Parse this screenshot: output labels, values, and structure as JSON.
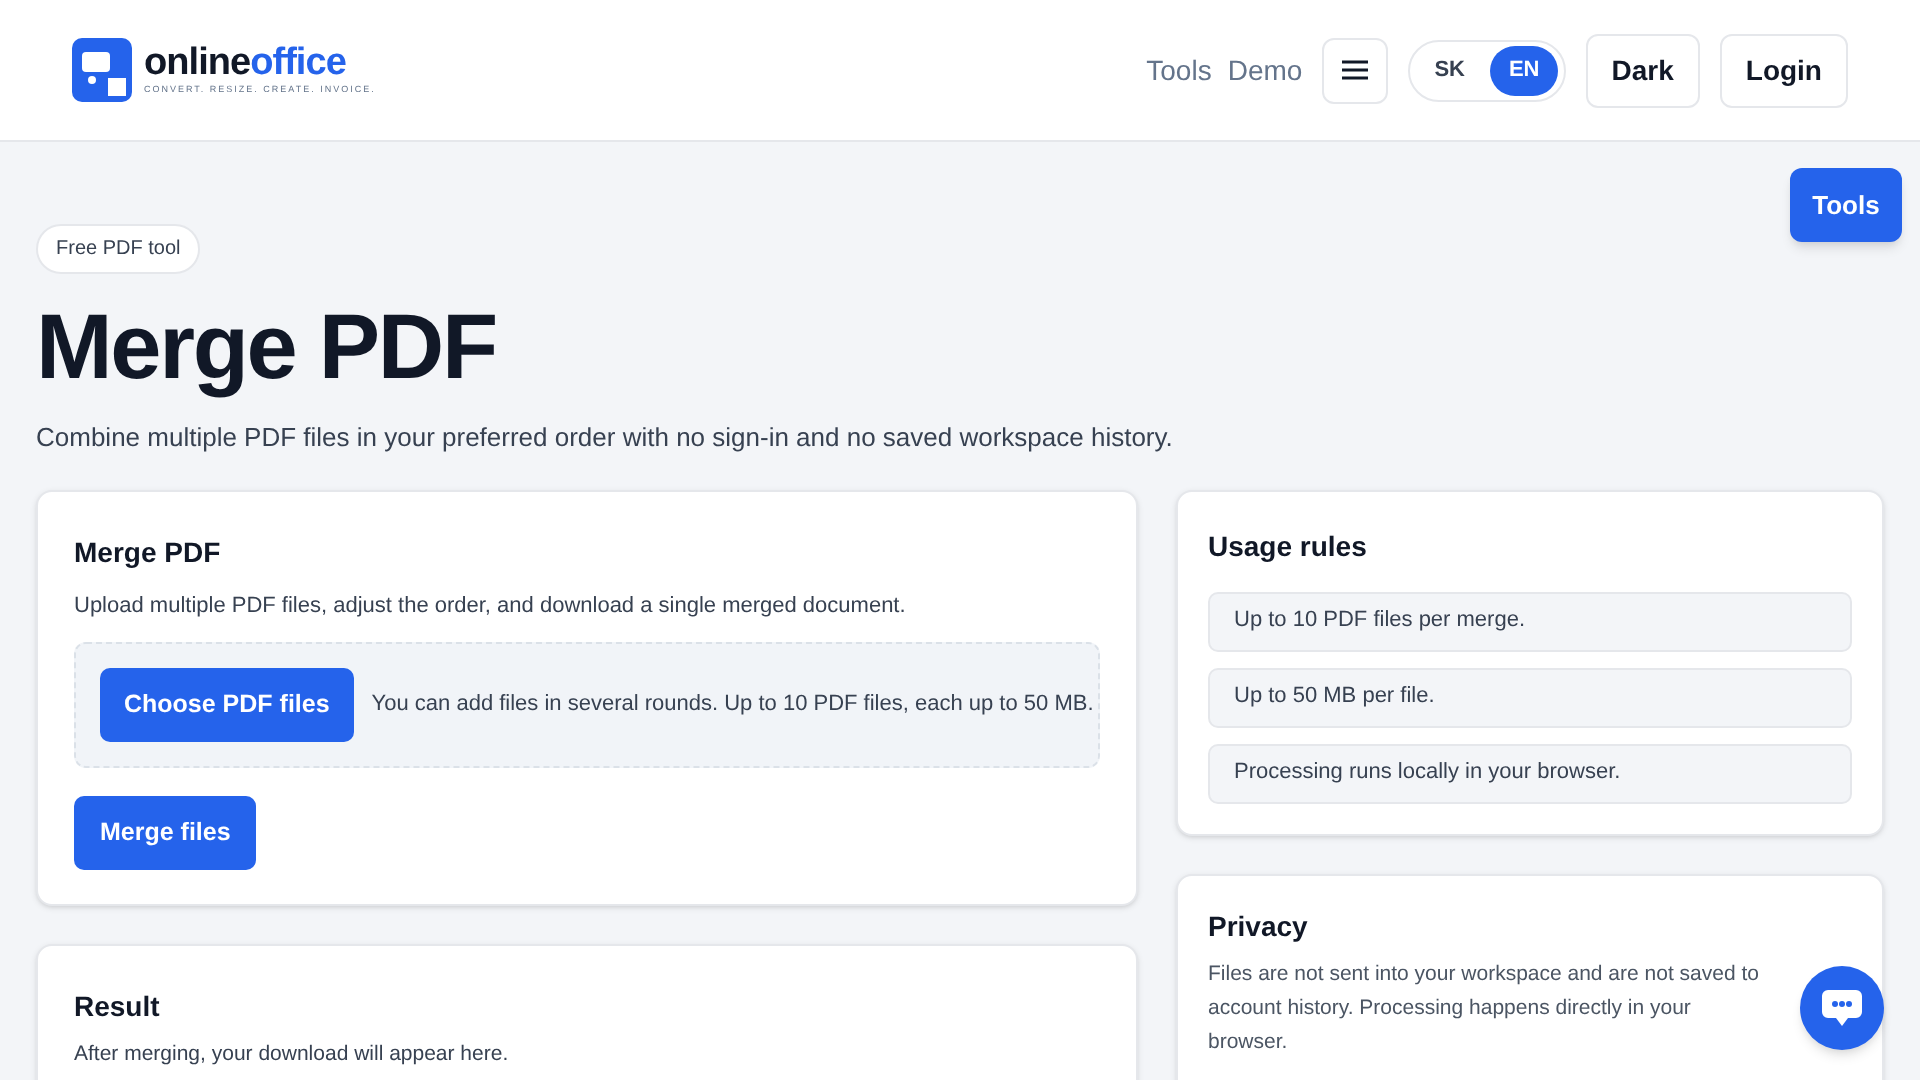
{
  "logo": {
    "name_dark": "online",
    "name_accent": "office",
    "tagline": "CONVERT. RESIZE. CREATE. INVOICE."
  },
  "nav": {
    "links": [
      "Tools",
      "Demo"
    ],
    "languages": [
      {
        "label": "SK",
        "selected": false
      },
      {
        "label": "EN",
        "selected": true
      }
    ],
    "theme_button": "Dark",
    "login_button": "Login"
  },
  "floating_tools_button": "Tools",
  "hero": {
    "badge": "Free PDF tool",
    "title": "Merge PDF",
    "subtitle": "Combine multiple PDF files in your preferred order with no sign-in and no saved workspace history."
  },
  "merge_card": {
    "title": "Merge PDF",
    "description": "Upload multiple PDF files, adjust the order, and download a single merged document.",
    "choose_button": "Choose PDF files",
    "hint": "You can add files in several rounds. Up to 10 PDF files, each up to 50 MB.",
    "merge_button": "Merge files"
  },
  "result_card": {
    "title": "Result",
    "text": "After merging, your download will appear here."
  },
  "usage_card": {
    "title": "Usage rules",
    "rules": [
      "Up to 10 PDF files per merge.",
      "Up to 50 MB per file.",
      "Processing runs locally in your browser."
    ]
  },
  "privacy_card": {
    "title": "Privacy",
    "text": "Files are not sent into your workspace and are not saved to account history. Processing happens directly in your browser."
  }
}
